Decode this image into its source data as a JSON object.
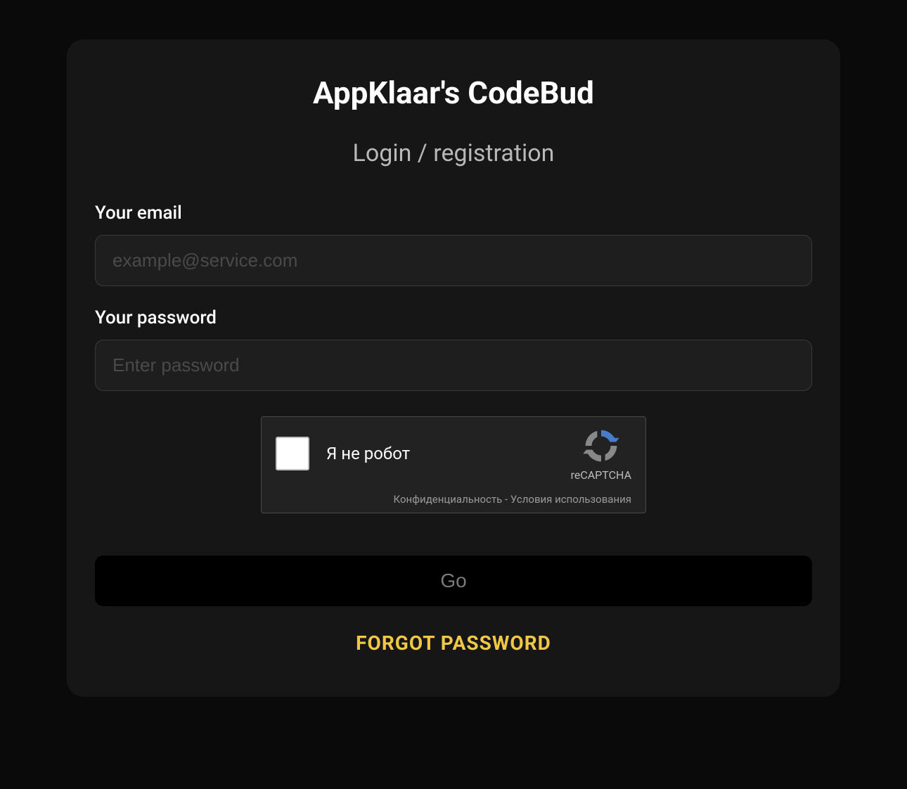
{
  "header": {
    "title": "AppKlaar's CodeBud",
    "subtitle": "Login / registration"
  },
  "form": {
    "email": {
      "label": "Your email",
      "placeholder": "example@service.com",
      "value": ""
    },
    "password": {
      "label": "Your password",
      "placeholder": "Enter password",
      "value": ""
    }
  },
  "recaptcha": {
    "label": "Я не робот",
    "brand": "reCAPTCHA",
    "privacy": "Конфиденциальность",
    "separator": " - ",
    "terms": "Условия использования"
  },
  "actions": {
    "submit": "Go",
    "forgot": "FORGOT PASSWORD"
  }
}
